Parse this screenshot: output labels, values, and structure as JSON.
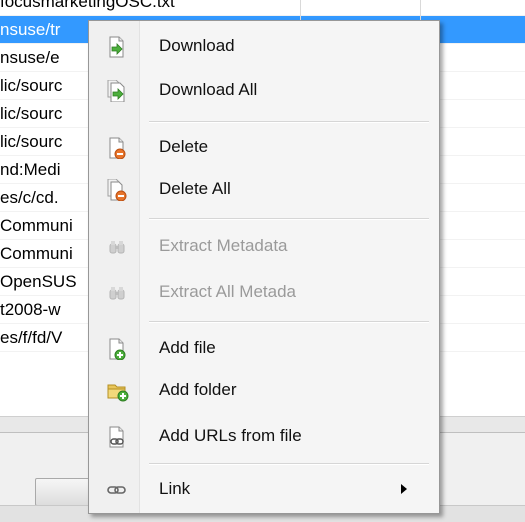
{
  "list": {
    "top_partial": "focusmarketingOSC.txt",
    "rows": [
      {
        "text": "nsuse/tr",
        "selected": true
      },
      {
        "text": "nsuse/e"
      },
      {
        "text": "lic/sourc"
      },
      {
        "text": "lic/sourc"
      },
      {
        "text": "lic/sourc"
      },
      {
        "text": "nd:Medi"
      },
      {
        "text": "es/c/cd."
      },
      {
        "text": "Communi"
      },
      {
        "text": "Communi"
      },
      {
        "text": "OpenSUS"
      },
      {
        "text": "t2008-w"
      },
      {
        "text": "es/f/fd/V"
      }
    ],
    "error_mark": "✕"
  },
  "context_menu": {
    "items": [
      {
        "label": "Download",
        "icon": "download-icon",
        "enabled": true
      },
      {
        "label": "Download All",
        "icon": "download-all-icon",
        "enabled": true
      },
      {
        "label": "Delete",
        "icon": "delete-icon",
        "enabled": true
      },
      {
        "label": "Delete All",
        "icon": "delete-all-icon",
        "enabled": true
      },
      {
        "label": "Extract Metadata",
        "icon": "binoculars-icon",
        "enabled": false
      },
      {
        "label": "Extract All Metada",
        "icon": "binoculars-icon",
        "enabled": false
      },
      {
        "label": "Add file",
        "icon": "add-file-icon",
        "enabled": true
      },
      {
        "label": "Add folder",
        "icon": "add-folder-icon",
        "enabled": true
      },
      {
        "label": "Add URLs from file",
        "icon": "add-urls-icon",
        "enabled": true
      },
      {
        "label": "Link",
        "icon": "link-icon",
        "enabled": true,
        "submenu": true
      }
    ]
  },
  "colors": {
    "selection": "#3399ff",
    "green_arrow": "#4caf3c",
    "orange_badge": "#e8742a",
    "folder_yellow": "#e9c65a"
  }
}
